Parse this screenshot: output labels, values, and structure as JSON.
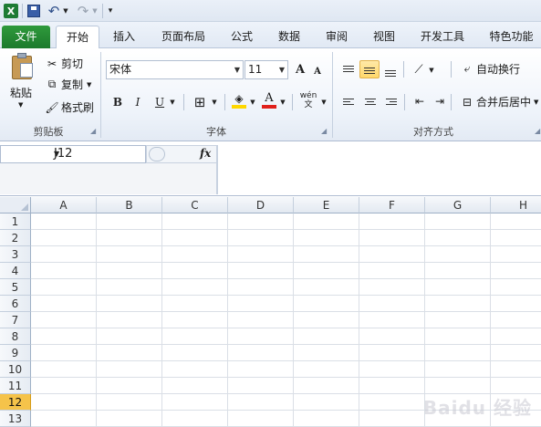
{
  "quick_access": {
    "logo": "X"
  },
  "tabs": [
    {
      "label": "文件"
    },
    {
      "label": "开始"
    },
    {
      "label": "插入"
    },
    {
      "label": "页面布局"
    },
    {
      "label": "公式"
    },
    {
      "label": "数据"
    },
    {
      "label": "审阅"
    },
    {
      "label": "视图"
    },
    {
      "label": "开发工具"
    },
    {
      "label": "特色功能"
    }
  ],
  "clipboard": {
    "paste": "粘贴",
    "cut": "剪切",
    "copy": "复制",
    "format_painter": "格式刷",
    "group_label": "剪贴板"
  },
  "font": {
    "name": "宋体",
    "size": "11",
    "group_label": "字体",
    "bold": "B",
    "italic": "I",
    "underline": "U",
    "grow": "A",
    "shrink": "A",
    "color_a": "A",
    "phonetic": "wén文"
  },
  "alignment": {
    "wrap": "自动换行",
    "merge": "合并后居中",
    "group_label": "对齐方式"
  },
  "formula_bar": {
    "name_box": "J12",
    "fx": "fx",
    "formula": ""
  },
  "columns": [
    "A",
    "B",
    "C",
    "D",
    "E",
    "F",
    "G",
    "H"
  ],
  "rows": [
    "1",
    "2",
    "3",
    "4",
    "5",
    "6",
    "7",
    "8",
    "9",
    "10",
    "11",
    "12",
    "13"
  ],
  "selected_row": "12",
  "watermark": "Baidu 经验",
  "colors": {
    "file_tab": "#1c7a2c",
    "fill_highlight": "#ffd800",
    "font_red": "#e0201b",
    "selected_row": "#f5c34a"
  }
}
